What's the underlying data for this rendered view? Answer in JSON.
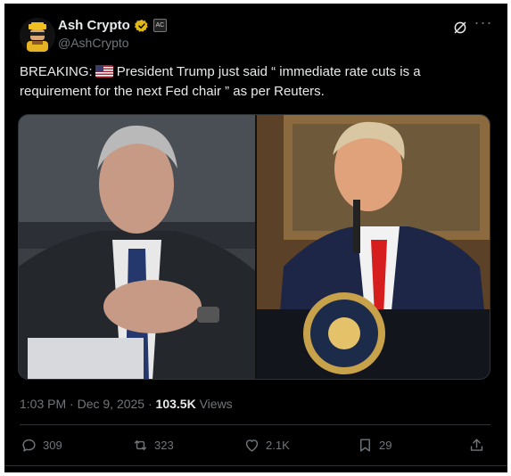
{
  "author": {
    "display_name": "Ash Crypto",
    "handle": "@AshCrypto",
    "affiliate_badge": "AC"
  },
  "tweet": {
    "text_before_flag": "BREAKING:",
    "text_after_flag": "President Trump just said “ immediate rate cuts is a requirement for the next Fed chair ” as per Reuters."
  },
  "meta": {
    "time": "1:03 PM",
    "separator": "·",
    "date": "Dec 9, 2025",
    "views_count": "103.5K",
    "views_label": "Views"
  },
  "actions": {
    "replies": "309",
    "reposts": "323",
    "likes": "2.1K",
    "bookmarks": "29"
  },
  "colors": {
    "background": "#000000",
    "text_primary": "#e7e9ea",
    "text_secondary": "#71767b",
    "divider": "#2f3336",
    "verified_gold": "#e2b719"
  },
  "icons": [
    "verified-badge-icon",
    "grok-icon",
    "more-icon",
    "reply-icon",
    "repost-icon",
    "like-icon",
    "bookmark-icon",
    "share-icon",
    "us-flag-icon"
  ]
}
